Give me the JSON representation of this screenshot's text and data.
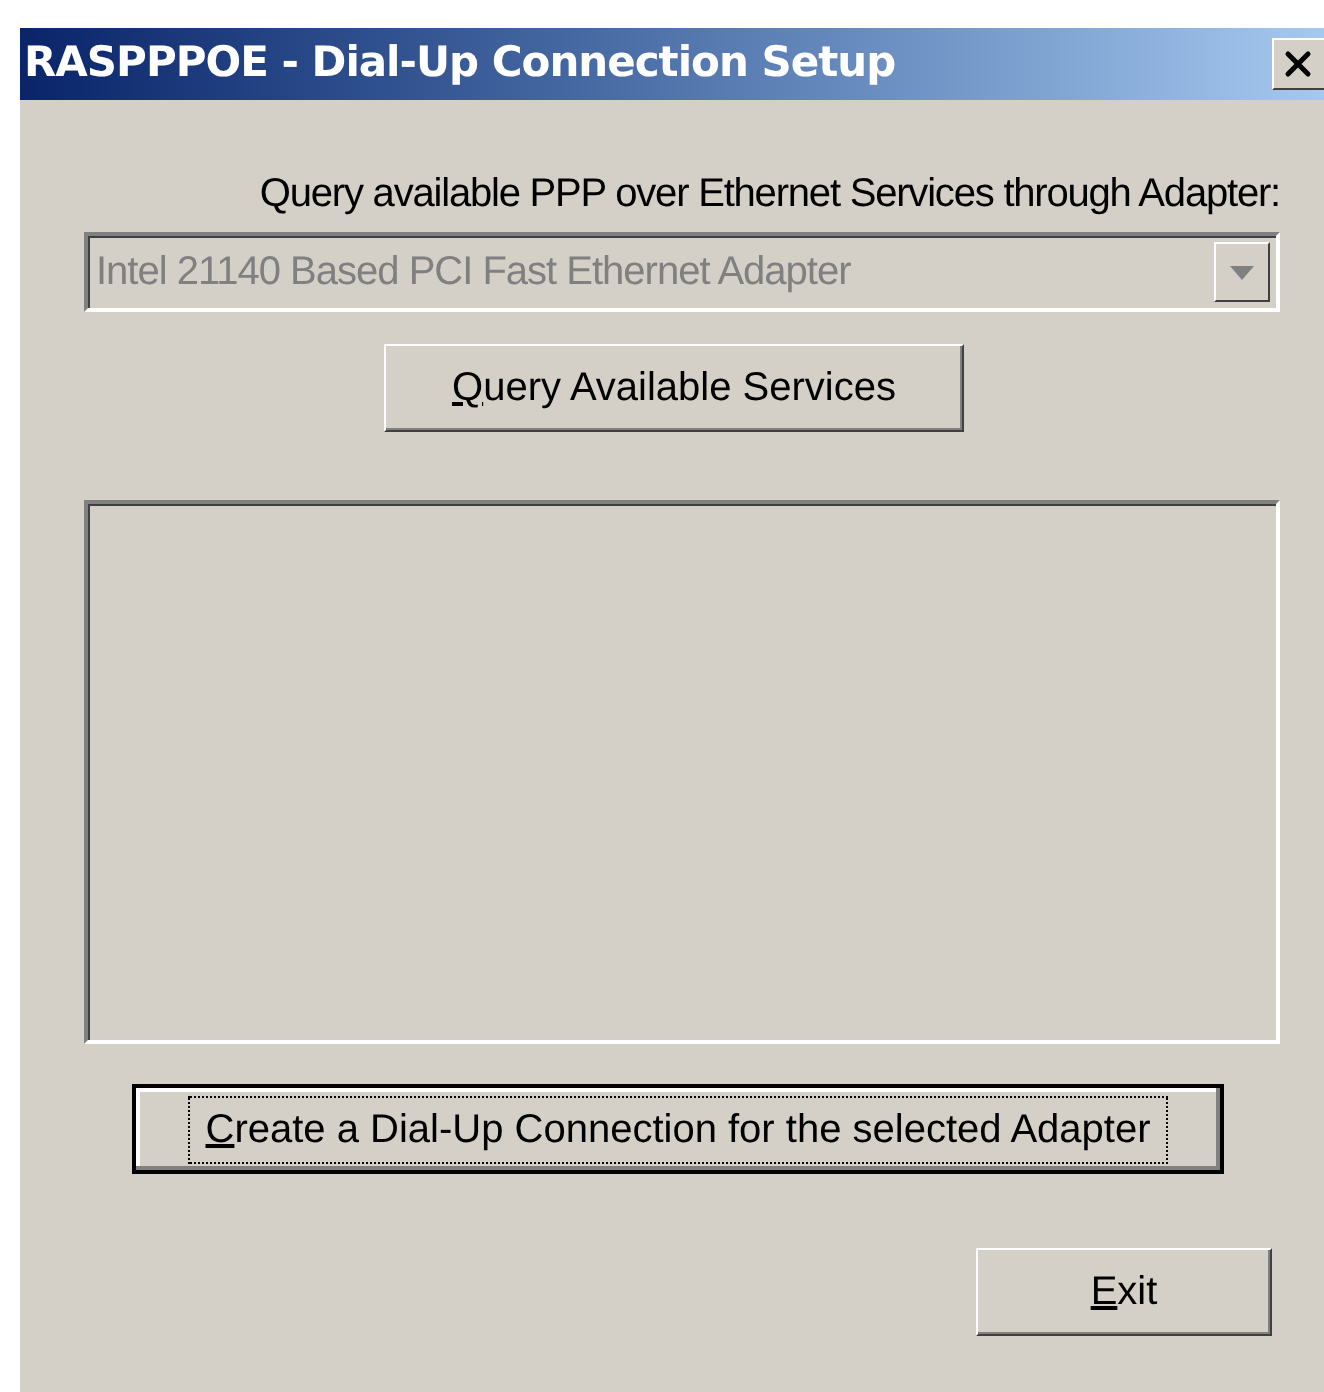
{
  "window": {
    "title": "RASPPPOE - Dial-Up Connection Setup"
  },
  "adapter_label": "Query available PPP over Ethernet Services through Adapter:",
  "adapter_combo": {
    "value": "Intel 21140 Based PCI Fast Ethernet Adapter",
    "disabled": true
  },
  "query_button": {
    "mnemonic": "Q",
    "label": "uery Available Services",
    "focused": false
  },
  "create_button": {
    "mnemonic": "C",
    "label": "reate a Dial-Up Connection for the selected Adapter",
    "focused": true
  },
  "exit_button": {
    "mnemonic": "E",
    "label": "xit",
    "focused": false
  }
}
